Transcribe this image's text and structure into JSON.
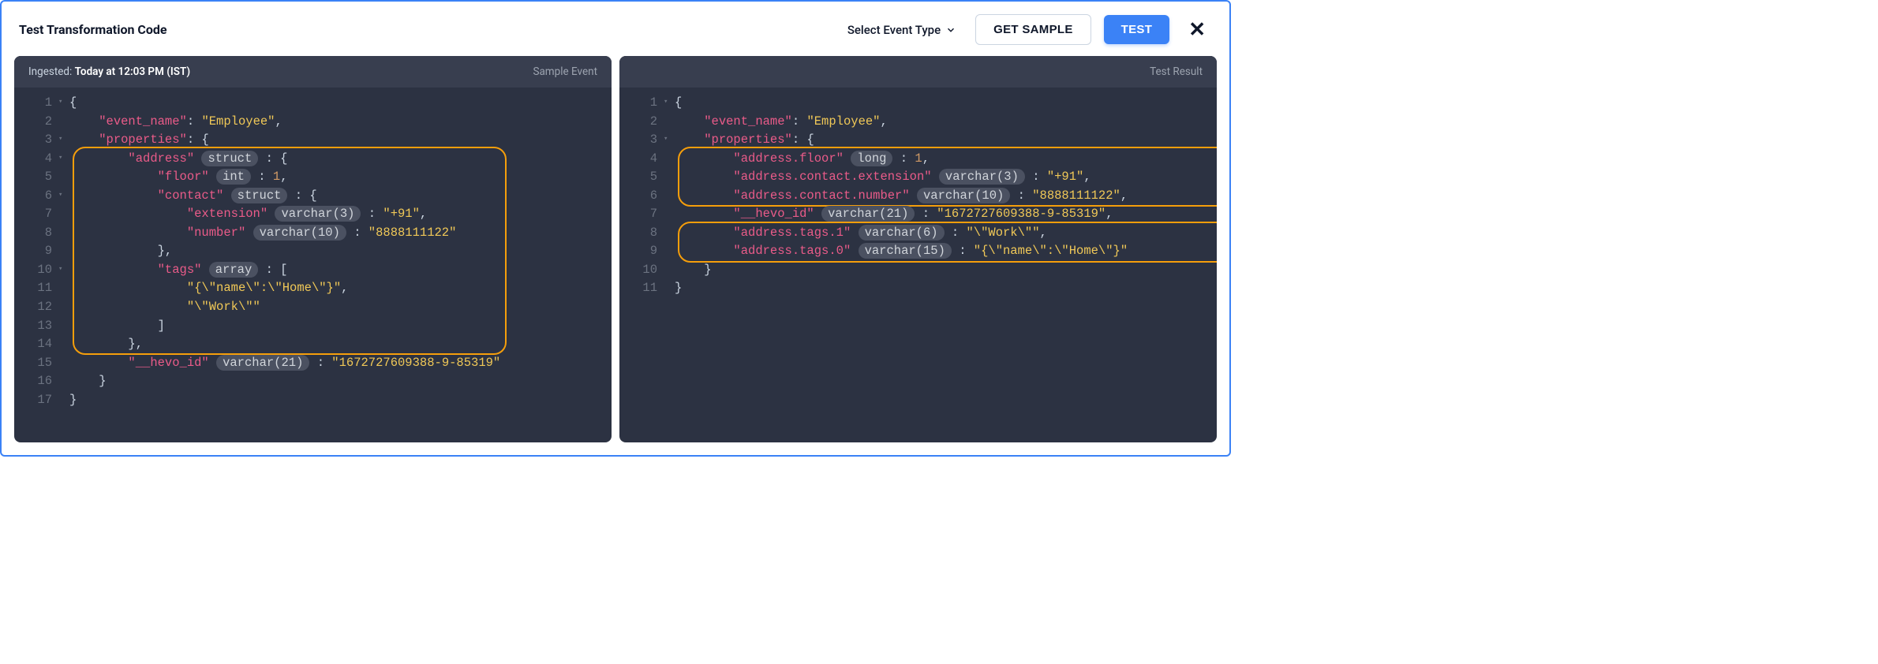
{
  "header": {
    "title": "Test Transformation Code",
    "select_label": "Select Event Type",
    "get_sample": "GET SAMPLE",
    "test": "TEST"
  },
  "leftPanel": {
    "ingested_label": "Ingested:",
    "ingested_time": "Today at 12:03 PM (IST)",
    "head_right": "Sample Event",
    "lines": [
      {
        "n": "1",
        "fold": "▾",
        "tokens": [
          {
            "t": "{",
            "c": "punc"
          }
        ]
      },
      {
        "n": "2",
        "fold": "",
        "tokens": [
          {
            "t": "    ",
            "c": ""
          },
          {
            "t": "\"event_name\"",
            "c": "key"
          },
          {
            "t": ": ",
            "c": "punc"
          },
          {
            "t": "\"Employee\"",
            "c": "str"
          },
          {
            "t": ",",
            "c": "punc"
          }
        ]
      },
      {
        "n": "3",
        "fold": "▾",
        "tokens": [
          {
            "t": "    ",
            "c": ""
          },
          {
            "t": "\"properties\"",
            "c": "key"
          },
          {
            "t": ": {",
            "c": "punc"
          }
        ]
      },
      {
        "n": "4",
        "fold": "▾",
        "tokens": [
          {
            "t": "        ",
            "c": ""
          },
          {
            "t": "\"address\"",
            "c": "key"
          },
          {
            "t": " ",
            "c": ""
          },
          {
            "t": "struct",
            "c": "pill"
          },
          {
            "t": " : {",
            "c": "punc"
          }
        ]
      },
      {
        "n": "5",
        "fold": "",
        "tokens": [
          {
            "t": "            ",
            "c": ""
          },
          {
            "t": "\"floor\"",
            "c": "key"
          },
          {
            "t": " ",
            "c": ""
          },
          {
            "t": "int",
            "c": "pill"
          },
          {
            "t": " : ",
            "c": "punc"
          },
          {
            "t": "1",
            "c": "num"
          },
          {
            "t": ",",
            "c": "punc"
          }
        ]
      },
      {
        "n": "6",
        "fold": "▾",
        "tokens": [
          {
            "t": "            ",
            "c": ""
          },
          {
            "t": "\"contact\"",
            "c": "key"
          },
          {
            "t": " ",
            "c": ""
          },
          {
            "t": "struct",
            "c": "pill"
          },
          {
            "t": " : {",
            "c": "punc"
          }
        ]
      },
      {
        "n": "7",
        "fold": "",
        "tokens": [
          {
            "t": "                ",
            "c": ""
          },
          {
            "t": "\"extension\"",
            "c": "key"
          },
          {
            "t": " ",
            "c": ""
          },
          {
            "t": "varchar(3)",
            "c": "pill"
          },
          {
            "t": " : ",
            "c": "punc"
          },
          {
            "t": "\"+91\"",
            "c": "str"
          },
          {
            "t": ",",
            "c": "punc"
          }
        ]
      },
      {
        "n": "8",
        "fold": "",
        "tokens": [
          {
            "t": "                ",
            "c": ""
          },
          {
            "t": "\"number\"",
            "c": "key"
          },
          {
            "t": " ",
            "c": ""
          },
          {
            "t": "varchar(10)",
            "c": "pill"
          },
          {
            "t": " : ",
            "c": "punc"
          },
          {
            "t": "\"8888111122\"",
            "c": "str"
          }
        ]
      },
      {
        "n": "9",
        "fold": "",
        "tokens": [
          {
            "t": "            },",
            "c": "punc"
          }
        ]
      },
      {
        "n": "10",
        "fold": "▾",
        "tokens": [
          {
            "t": "            ",
            "c": ""
          },
          {
            "t": "\"tags\"",
            "c": "key"
          },
          {
            "t": " ",
            "c": ""
          },
          {
            "t": "array",
            "c": "pill"
          },
          {
            "t": " : [",
            "c": "punc"
          }
        ]
      },
      {
        "n": "11",
        "fold": "",
        "tokens": [
          {
            "t": "                ",
            "c": ""
          },
          {
            "t": "\"{\\\"name\\\":\\\"Home\\\"}\"",
            "c": "str"
          },
          {
            "t": ",",
            "c": "punc"
          }
        ]
      },
      {
        "n": "12",
        "fold": "",
        "tokens": [
          {
            "t": "                ",
            "c": ""
          },
          {
            "t": "\"\\\"Work\\\"\"",
            "c": "str"
          }
        ]
      },
      {
        "n": "13",
        "fold": "",
        "tokens": [
          {
            "t": "            ]",
            "c": "punc"
          }
        ]
      },
      {
        "n": "14",
        "fold": "",
        "tokens": [
          {
            "t": "        },",
            "c": "punc"
          }
        ]
      },
      {
        "n": "15",
        "fold": "",
        "tokens": [
          {
            "t": "        ",
            "c": ""
          },
          {
            "t": "\"__hevo_id\"",
            "c": "key"
          },
          {
            "t": " ",
            "c": ""
          },
          {
            "t": "varchar(21)",
            "c": "pill"
          },
          {
            "t": " : ",
            "c": "punc"
          },
          {
            "t": "\"1672727609388-9-85319\"",
            "c": "str"
          }
        ]
      },
      {
        "n": "16",
        "fold": "",
        "tokens": [
          {
            "t": "    }",
            "c": "punc"
          }
        ]
      },
      {
        "n": "17",
        "fold": "",
        "tokens": [
          {
            "t": "}",
            "c": "punc"
          }
        ]
      }
    ]
  },
  "rightPanel": {
    "head_right": "Test Result",
    "lines": [
      {
        "n": "1",
        "fold": "▾",
        "tokens": [
          {
            "t": "{",
            "c": "punc"
          }
        ]
      },
      {
        "n": "2",
        "fold": "",
        "tokens": [
          {
            "t": "    ",
            "c": ""
          },
          {
            "t": "\"event_name\"",
            "c": "key"
          },
          {
            "t": ": ",
            "c": "punc"
          },
          {
            "t": "\"Employee\"",
            "c": "str"
          },
          {
            "t": ",",
            "c": "punc"
          }
        ]
      },
      {
        "n": "3",
        "fold": "▾",
        "tokens": [
          {
            "t": "    ",
            "c": ""
          },
          {
            "t": "\"properties\"",
            "c": "key"
          },
          {
            "t": ": {",
            "c": "punc"
          }
        ]
      },
      {
        "n": "4",
        "fold": "",
        "tokens": [
          {
            "t": "        ",
            "c": ""
          },
          {
            "t": "\"address.floor\"",
            "c": "key"
          },
          {
            "t": " ",
            "c": ""
          },
          {
            "t": "long",
            "c": "pill"
          },
          {
            "t": " : ",
            "c": "punc"
          },
          {
            "t": "1",
            "c": "num"
          },
          {
            "t": ",",
            "c": "punc"
          }
        ]
      },
      {
        "n": "5",
        "fold": "",
        "tokens": [
          {
            "t": "        ",
            "c": ""
          },
          {
            "t": "\"address.contact.extension\"",
            "c": "key"
          },
          {
            "t": " ",
            "c": ""
          },
          {
            "t": "varchar(3)",
            "c": "pill"
          },
          {
            "t": " : ",
            "c": "punc"
          },
          {
            "t": "\"+91\"",
            "c": "str"
          },
          {
            "t": ",",
            "c": "punc"
          }
        ]
      },
      {
        "n": "6",
        "fold": "",
        "tokens": [
          {
            "t": "        ",
            "c": ""
          },
          {
            "t": "\"address.contact.number\"",
            "c": "key"
          },
          {
            "t": " ",
            "c": ""
          },
          {
            "t": "varchar(10)",
            "c": "pill"
          },
          {
            "t": " : ",
            "c": "punc"
          },
          {
            "t": "\"8888111122\"",
            "c": "str"
          },
          {
            "t": ",",
            "c": "punc"
          }
        ]
      },
      {
        "n": "7",
        "fold": "",
        "tokens": [
          {
            "t": "        ",
            "c": ""
          },
          {
            "t": "\"__hevo_id\"",
            "c": "key"
          },
          {
            "t": " ",
            "c": ""
          },
          {
            "t": "varchar(21)",
            "c": "pill"
          },
          {
            "t": " : ",
            "c": "punc"
          },
          {
            "t": "\"1672727609388-9-85319\"",
            "c": "str"
          },
          {
            "t": ",",
            "c": "punc"
          }
        ]
      },
      {
        "n": "8",
        "fold": "",
        "tokens": [
          {
            "t": "        ",
            "c": ""
          },
          {
            "t": "\"address.tags.1\"",
            "c": "key"
          },
          {
            "t": " ",
            "c": ""
          },
          {
            "t": "varchar(6)",
            "c": "pill"
          },
          {
            "t": " : ",
            "c": "punc"
          },
          {
            "t": "\"\\\"Work\\\"\"",
            "c": "str"
          },
          {
            "t": ",",
            "c": "punc"
          }
        ]
      },
      {
        "n": "9",
        "fold": "",
        "tokens": [
          {
            "t": "        ",
            "c": ""
          },
          {
            "t": "\"address.tags.0\"",
            "c": "key"
          },
          {
            "t": " ",
            "c": ""
          },
          {
            "t": "varchar(15)",
            "c": "pill"
          },
          {
            "t": " : ",
            "c": "punc"
          },
          {
            "t": "\"{\\\"name\\\":\\\"Home\\\"}\"",
            "c": "str"
          }
        ]
      },
      {
        "n": "10",
        "fold": "",
        "tokens": [
          {
            "t": "    }",
            "c": "punc"
          }
        ]
      },
      {
        "n": "11",
        "fold": "",
        "tokens": [
          {
            "t": "}",
            "c": "punc"
          }
        ]
      }
    ]
  }
}
